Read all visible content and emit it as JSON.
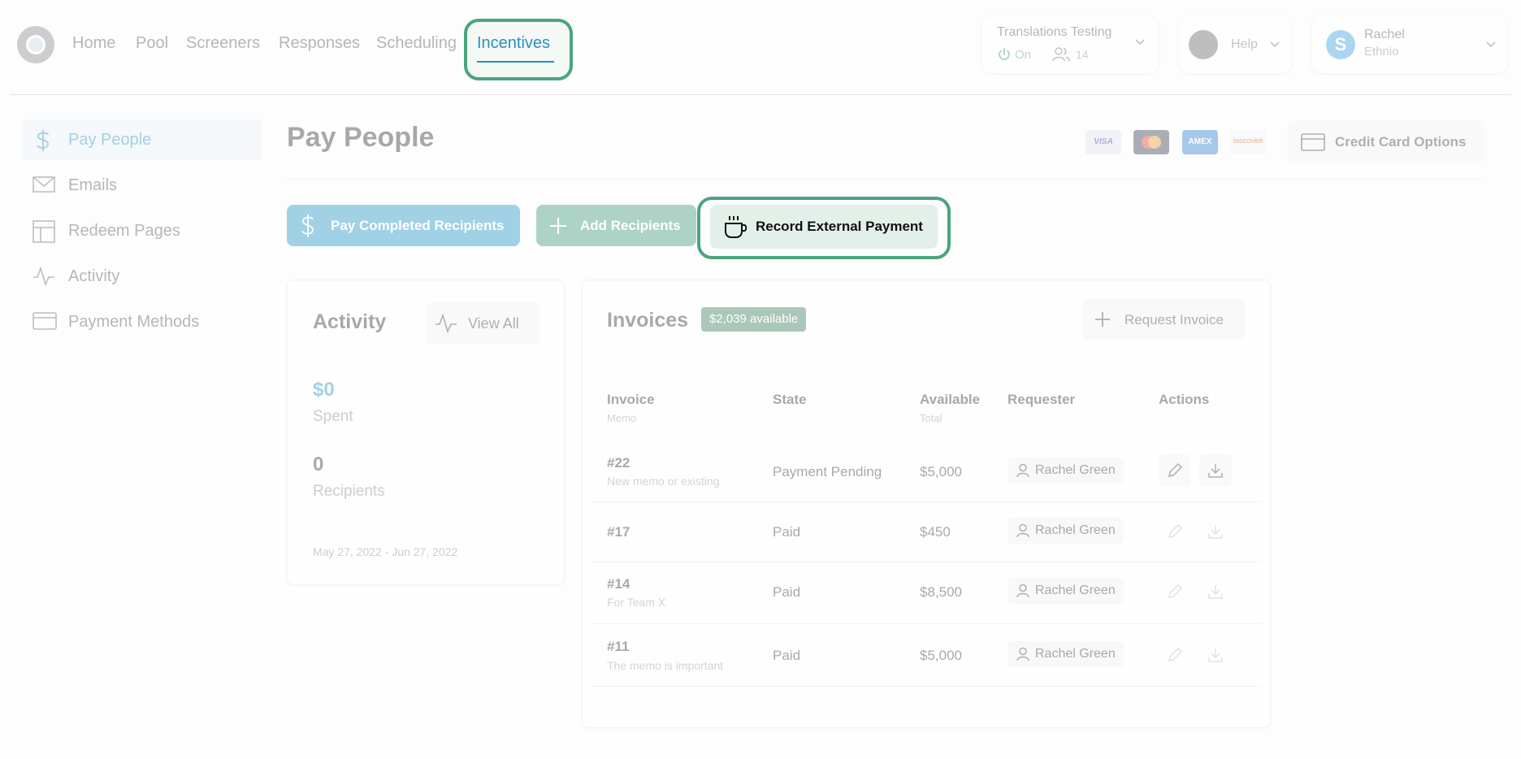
{
  "nav": {
    "items": [
      "Home",
      "Pool",
      "Screeners",
      "Responses",
      "Scheduling"
    ],
    "active": "Incentives"
  },
  "project": {
    "name": "Translations Testing",
    "status": "On",
    "count": "14"
  },
  "help": {
    "label": "Help"
  },
  "user": {
    "name": "Rachel",
    "org": "Ethnio",
    "avatar_letter": "S"
  },
  "sidebar": {
    "items": [
      {
        "label": "Pay People",
        "icon": "dollar-icon"
      },
      {
        "label": "Emails",
        "icon": "envelope-icon"
      },
      {
        "label": "Redeem Pages",
        "icon": "layout-icon"
      },
      {
        "label": "Activity",
        "icon": "pulse-icon"
      },
      {
        "label": "Payment Methods",
        "icon": "credit-card-icon"
      }
    ]
  },
  "page": {
    "title": "Pay People",
    "cards": [
      "VISA",
      "MC",
      "AMEX",
      "DISCOVER"
    ],
    "credit_card_options": "Credit Card Options"
  },
  "actions": {
    "pay_completed": "Pay Completed Recipients",
    "add_recipients": "Add Recipients",
    "record_external": "Record External Payment"
  },
  "activity": {
    "title": "Activity",
    "view_all": "View All",
    "spent_value": "$0",
    "spent_label": "Spent",
    "recipients_value": "0",
    "recipients_label": "Recipients",
    "date_range": "May 27, 2022 - Jun 27, 2022"
  },
  "invoices": {
    "title": "Invoices",
    "available_badge": "$2,039 available",
    "request_button": "Request Invoice",
    "headers": {
      "invoice": "Invoice",
      "memo": "Memo",
      "state": "State",
      "available": "Available",
      "total": "Total",
      "requester": "Requester",
      "actions": "Actions"
    },
    "rows": [
      {
        "number": "#22",
        "memo": "New memo or existing",
        "state": "Payment Pending",
        "amount": "$5,000",
        "requester": "Rachel Green"
      },
      {
        "number": "#17",
        "memo": "",
        "state": "Paid",
        "amount": "$450",
        "requester": "Rachel Green"
      },
      {
        "number": "#14",
        "memo": "For Team X",
        "state": "Paid",
        "amount": "$8,500",
        "requester": "Rachel Green"
      },
      {
        "number": "#11",
        "memo": "The memo is important",
        "state": "Paid",
        "amount": "$5,000",
        "requester": "Rachel Green"
      }
    ]
  },
  "colors": {
    "accent": "#2a8fbf",
    "highlight": "#4aa57d",
    "pay_button": "#7fbfdc",
    "add_button": "#7fb8a4",
    "record_button": "#e3efe9"
  }
}
